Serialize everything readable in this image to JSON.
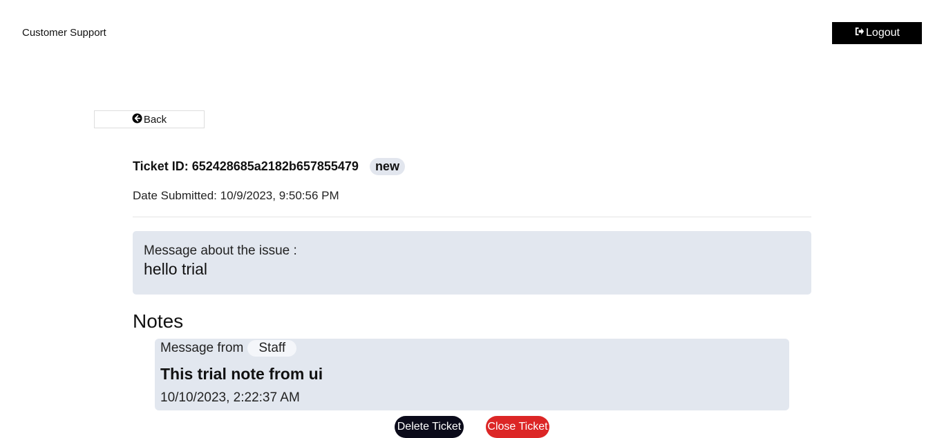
{
  "header": {
    "brand": "Customer Support",
    "logout_label": "Logout"
  },
  "nav": {
    "back_label": "Back"
  },
  "ticket": {
    "id_label": "Ticket ID: 652428685a2182b657855479",
    "status": "new",
    "date_submitted": "Date Submitted: 10/9/2023, 9:50:56 PM",
    "issue_label": "Message about the issue :",
    "issue_text": "hello trial"
  },
  "notes": {
    "heading": "Notes",
    "items": [
      {
        "from_label": "Message from",
        "author": "Staff",
        "text": "This trial note from ui",
        "date": "10/10/2023, 2:22:37 AM"
      }
    ]
  },
  "actions": {
    "delete_label": "Delete Ticket",
    "close_label": "Close Ticket"
  },
  "icons": {
    "logout": "sign-out-icon",
    "back": "arrow-circle-left-icon"
  },
  "colors": {
    "logout_bg": "#000000",
    "panel_bg": "#e2e7ef",
    "delete_bg": "#0b0b1a",
    "close_bg": "#dc2626"
  }
}
